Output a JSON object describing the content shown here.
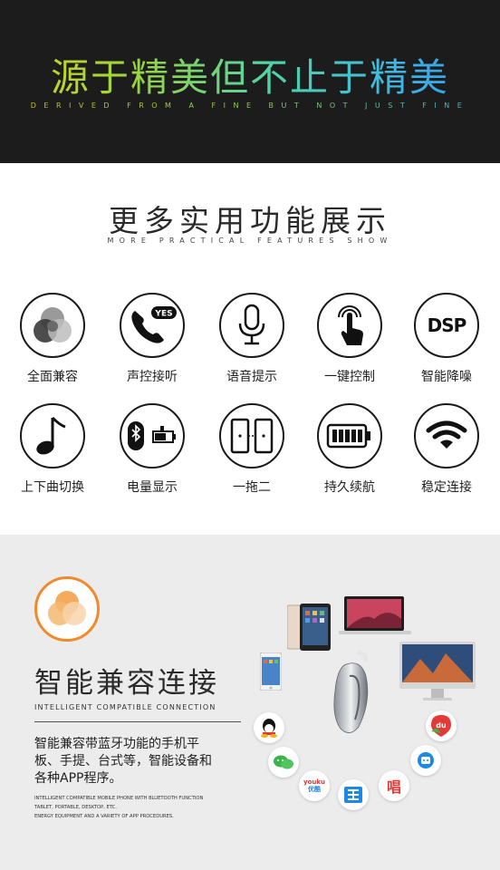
{
  "banner": {
    "title": "源于精美但不止于精美",
    "subtitle": "DERIVED FROM A FINE BUT NOT JUST FINE"
  },
  "features": {
    "title": "更多实用功能展示",
    "subtitle": "MORE PRACTICAL FEATURES SHOW",
    "items": [
      {
        "label": "全面兼容",
        "icon": "overlap-circles-icon"
      },
      {
        "label": "声控接听",
        "icon": "phone-yes-icon",
        "badge": "YES"
      },
      {
        "label": "语音提示",
        "icon": "microphone-icon"
      },
      {
        "label": "一键控制",
        "icon": "finger-press-icon"
      },
      {
        "label": "智能降噪",
        "icon": "dsp-icon",
        "badge": "DSP"
      },
      {
        "label": "上下曲切换",
        "icon": "music-note-icon"
      },
      {
        "label": "电量显示",
        "icon": "bluetooth-battery-icon"
      },
      {
        "label": "一拖二",
        "icon": "two-phones-icon"
      },
      {
        "label": "持久续航",
        "icon": "battery-icon"
      },
      {
        "label": "稳定连接",
        "icon": "wifi-icon"
      }
    ]
  },
  "compat": {
    "title": "智能兼容连接",
    "subtitle": "INTELLIGENT COMPATIBLE CONNECTION",
    "description": "智能兼容带蓝牙功能的手机平板、手提、台式等，智能设备和各种APP程序。",
    "small_lines": [
      "INTELLIGENT COMPATIBLE MOBILE PHONE WITH BLUETOOTH FUNCTION",
      "TABLET, PORTABLE, DESKTOP, ETC.",
      "ENERGY EQUIPMENT AND A VARIETY OF APP PROCEDURES."
    ],
    "apps": {
      "youku_line1": "youku",
      "youku_line2": "优酷",
      "baidu": "du",
      "sing": "唱"
    }
  },
  "colors": {
    "banner_bg": "#1c1c1c",
    "accent_orange": "#f08a2b",
    "compat_bg": "#ececec"
  }
}
